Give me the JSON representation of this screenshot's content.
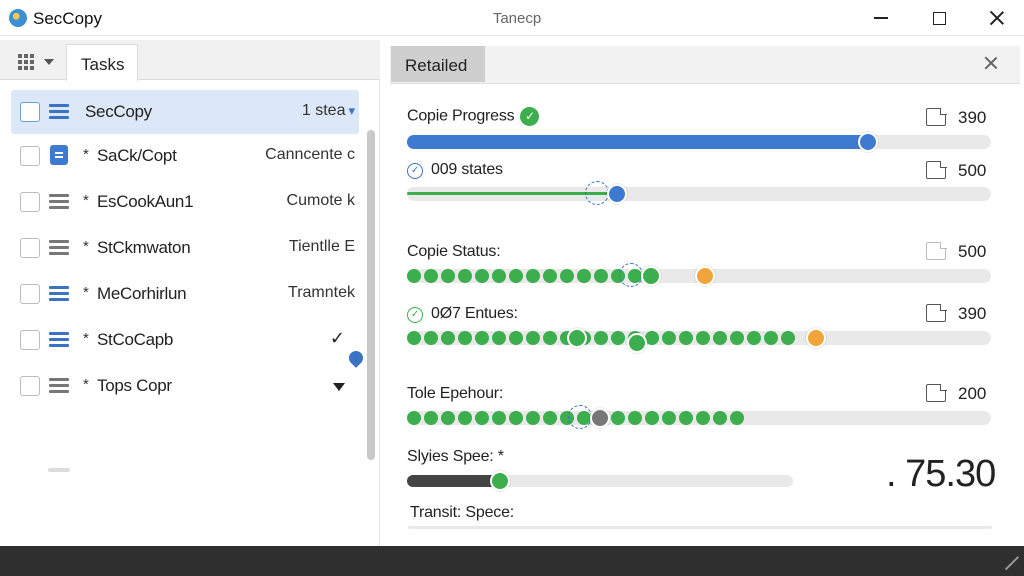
{
  "titlebar": {
    "app_name": "SecCopy",
    "window_title": "Tanecp"
  },
  "left": {
    "tab_label": "Tasks",
    "tasks": [
      {
        "name": "SecCopy",
        "status": "1 stea",
        "selected": true,
        "icon": "list-lines-blue-icon"
      },
      {
        "name": "SaCk/Copt",
        "status": "Canncente c",
        "icon": "document-icon"
      },
      {
        "name": "EsCookAun1",
        "status": "Cumote k",
        "icon": "list-lines-gray-icon"
      },
      {
        "name": "StCkmwaton",
        "status": "Tientlle E",
        "icon": "list-lines-gray-icon"
      },
      {
        "name": "MeCorhirlun",
        "status": "Tramntek",
        "icon": "list-lines-blue-icon"
      },
      {
        "name": "StCoCapb",
        "status": "",
        "indicator": "checkmark-icon",
        "icon": "list-lines-blue-icon"
      },
      {
        "name": "Tops Copr",
        "status": "",
        "indicator": "triangle-down-icon",
        "icon": "list-lines-gray-icon"
      }
    ]
  },
  "right": {
    "tab_label": "Retailed",
    "stats": {
      "copie_progress": {
        "label": "Copie Progress",
        "value": "390",
        "progress": 0.79
      },
      "states": {
        "label": "009 states",
        "value": "500",
        "progress": 0.36
      },
      "copie_status": {
        "label": "Copie Status:",
        "value": "500",
        "progress": 0.51
      },
      "entues": {
        "label": "0Ø7 Entues:",
        "value": "390",
        "progress": 0.7
      },
      "tole_epehour": {
        "label": "Tole Epehour:",
        "value": "200",
        "progress": 0.33
      },
      "styles_speed": {
        "label": "Slyies Spee: *",
        "big_value": ". 75.30",
        "progress": 0.24
      },
      "transit_speed": {
        "label": "Transit: Spece:"
      }
    }
  },
  "colors": {
    "accent_blue": "#3f7ad1",
    "success_green": "#3cae4e",
    "warning_orange": "#f2a43a",
    "status_bar": "#2f2f2f"
  }
}
